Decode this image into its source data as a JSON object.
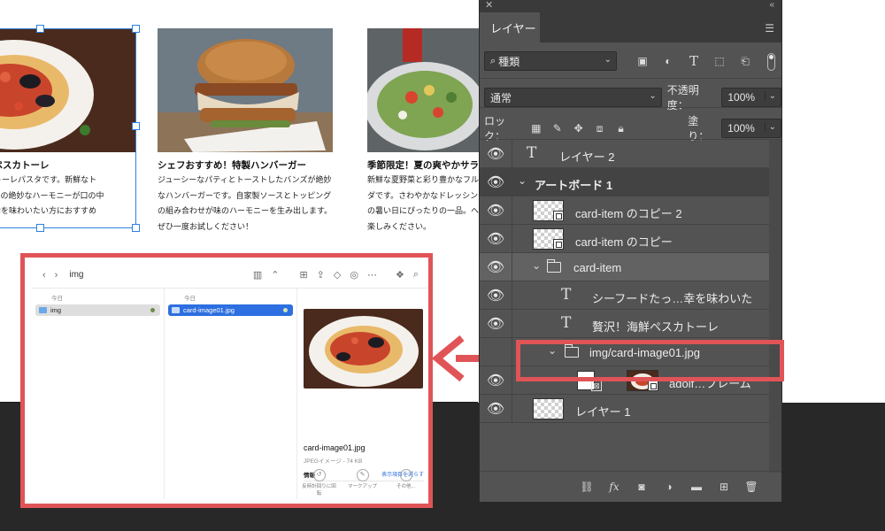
{
  "cards": [
    {
      "title": "贅沢！海鮮ペスカトーレ",
      "desc": "ぷりっぷりのペスカトーレパスタです。新鮮なトマトソースの絶妙なハーモニーが口の中に。海の幸を味わいたい方におすすめ"
    },
    {
      "title": "シェフおすすめ！特製ハンバーガー",
      "desc": "ジューシーなパティとトーストしたバンズが絶妙なハンバーガーです。自家製ソースとトッピングの組み合わせが味のハーモニーを生み出します。ぜひ一度お試しください！"
    },
    {
      "title": "季節限定！夏の爽やかサラダ",
      "desc": "新鮮な夏野菜と彩り豊かなフルーツを使ったサラダです。さわやかなドレッシングをかければ、夏の暑い日にぴったりの一品。ヘルシーな一口をお楽しみください。"
    }
  ],
  "finder": {
    "folder_title": "img",
    "col1_label": "今日",
    "col2_label": "今日",
    "col1_item": "img",
    "col2_item": "card-image01.jpg",
    "preview_name": "card-image01.jpg",
    "preview_kind": "JPEGイメージ - 74 KB",
    "info_label": "情報",
    "show_more": "表示項目を減らす",
    "actions": [
      "反時計回りに回転",
      "マークアップ",
      "その他..."
    ]
  },
  "panel": {
    "tab": "レイヤー",
    "filter_kind": "種類",
    "blend_mode": "通常",
    "opacity_label": "不透明度：",
    "opacity_value": "100%",
    "lock_label": "ロック：",
    "fill_label": "塗り：",
    "fill_value": "100%",
    "layers": [
      {
        "name": "レイヤー 2"
      },
      {
        "name": "アートボード 1"
      },
      {
        "name": "card-item のコピー 2"
      },
      {
        "name": "card-item のコピー"
      },
      {
        "name": "card-item"
      },
      {
        "name": "シーフードたっ…幸を味わいた"
      },
      {
        "name": "贅沢！海鮮ペスカトーレ"
      },
      {
        "name": "img/card-image01.jpg"
      },
      {
        "name": "adolf…フレーム"
      },
      {
        "name": "レイヤー 1"
      }
    ]
  },
  "colors": {
    "highlight": "#e05457",
    "selection": "#2f7fe0",
    "panel_bg": "#535353"
  },
  "icons": [
    "close-icon",
    "collapse-icon",
    "panel-menu-icon",
    "search-icon",
    "eye-icon",
    "folder-icon",
    "text-layer-icon",
    "link-icon",
    "fx-icon",
    "mask-icon",
    "adjustment-icon",
    "new-group-icon",
    "new-layer-icon",
    "trash-icon"
  ]
}
